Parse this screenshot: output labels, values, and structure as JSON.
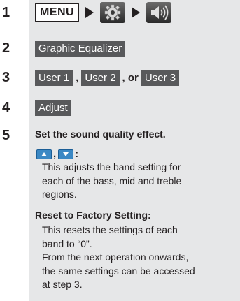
{
  "steps": [
    {
      "number": "1"
    },
    {
      "number": "2",
      "button": "Graphic Equalizer"
    },
    {
      "number": "3",
      "buttons": [
        "User 1",
        "User 2",
        "User 3"
      ],
      "separators": [
        ",",
        ", or"
      ]
    },
    {
      "number": "4",
      "button": "Adjust"
    },
    {
      "number": "5",
      "heading": "Set the sound quality effect."
    }
  ],
  "step1": {
    "menu_label": "MENU",
    "icons": [
      "settings-gear-icon",
      "speaker-sound-icon"
    ]
  },
  "step5": {
    "adjust_buttons_separator": ",",
    "adjust_buttons_colon": ":",
    "adjust_desc": [
      "This adjusts the band setting for",
      "each of the bass, mid and treble",
      "regions."
    ],
    "reset_heading": "Reset to Factory Setting:",
    "reset_desc": [
      "This resets the settings of each",
      "band to “0”.",
      "From the next operation onwards,",
      "the same settings can be accessed",
      "at step 3."
    ]
  },
  "colors": {
    "band": "#e6e7e8",
    "button": "#58595b",
    "arrow_button": "#3b88c4"
  }
}
